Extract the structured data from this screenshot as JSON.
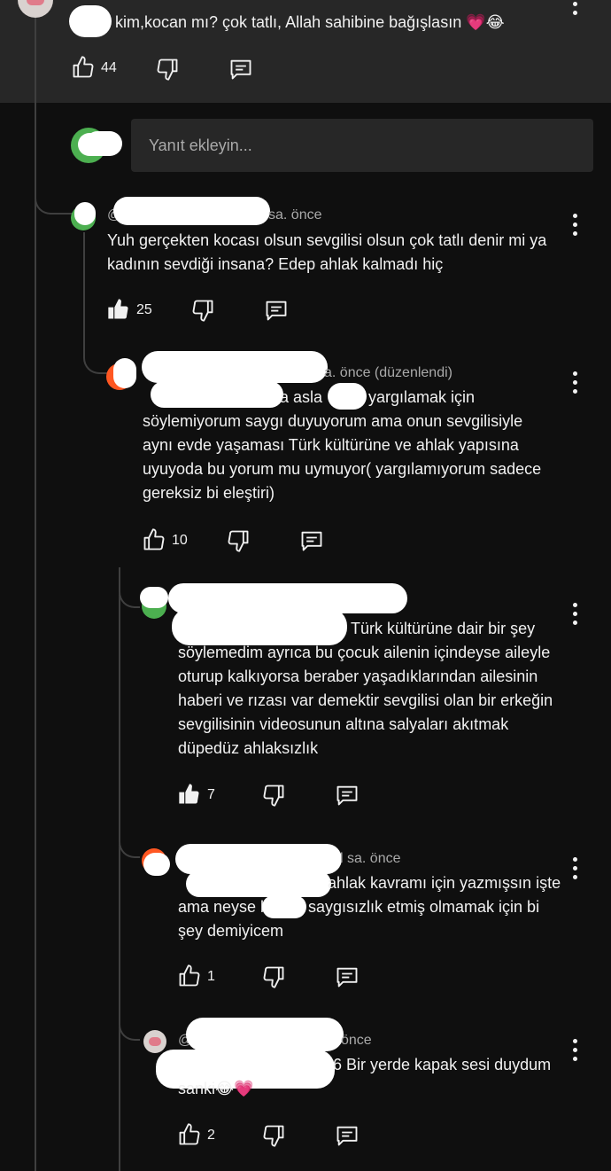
{
  "top_comment": {
    "text": "kim,kocan mı? çok tatlı, Allah sahibine bağışlasın 💗😂",
    "likes": "44"
  },
  "reply_box": {
    "placeholder": "Yanıt ekleyin..."
  },
  "replies": [
    {
      "meta_prefix": "@",
      "meta": "sa. önce",
      "lines": [
        "Yuh gerçekten kocası olsun sevgilisi olsun çok tatlı denir mi ya",
        "kadının sevdiği insana? Edep ahlak kalmadı hiç"
      ],
      "likes": "25"
    },
    {
      "meta": "a. önce (düzenlendi)",
      "lines": [
        "a asla",
        "yargılamak için",
        "söylemiyorum  saygı duyuyorum  ama onun sevgilisiyle",
        "aynı evde yaşaması Türk kültürüne ve ahlak yapısına",
        "uyuyoda bu yorum mu uymuyor( yargılamıyorum sadece",
        "gereksiz bi eleştiri)"
      ],
      "likes": "10"
    },
    {
      "lines": [
        "Türk kültürüne dair bir şey",
        "söylemedim ayrıca bu çocuk ailenin içindeyse aileyle",
        "oturup kalkıyorsa beraber yaşadıklarından ailesinin",
        "haberi ve rızası var demektir sevgilisi olan bir erkeğin",
        "sevgilisinin videosunun altına salyaları akıtmak",
        "düpedüz ahlaksızlık"
      ],
      "likes": "7"
    },
    {
      "meta": "l sa. önce",
      "lines": [
        "ahlak kavramı için yazmışsın işte",
        "ama neyse b",
        "saygısızlık etmiş olmamak için bi",
        "şey demiyicem"
      ],
      "likes": "1"
    },
    {
      "meta_prefix": "@",
      "meta": "önce",
      "lines": [
        "@",
        "6 Bir yerde kapak sesi duydum",
        "sanki😂💗"
      ],
      "likes": "2"
    }
  ],
  "colors": {
    "background": "#0f0f0f",
    "top_band": "#272727",
    "text": "#f1f1f1",
    "meta": "#aaaaaa",
    "thread_line": "#3f3f3f",
    "mention": "#3ea6ff"
  }
}
